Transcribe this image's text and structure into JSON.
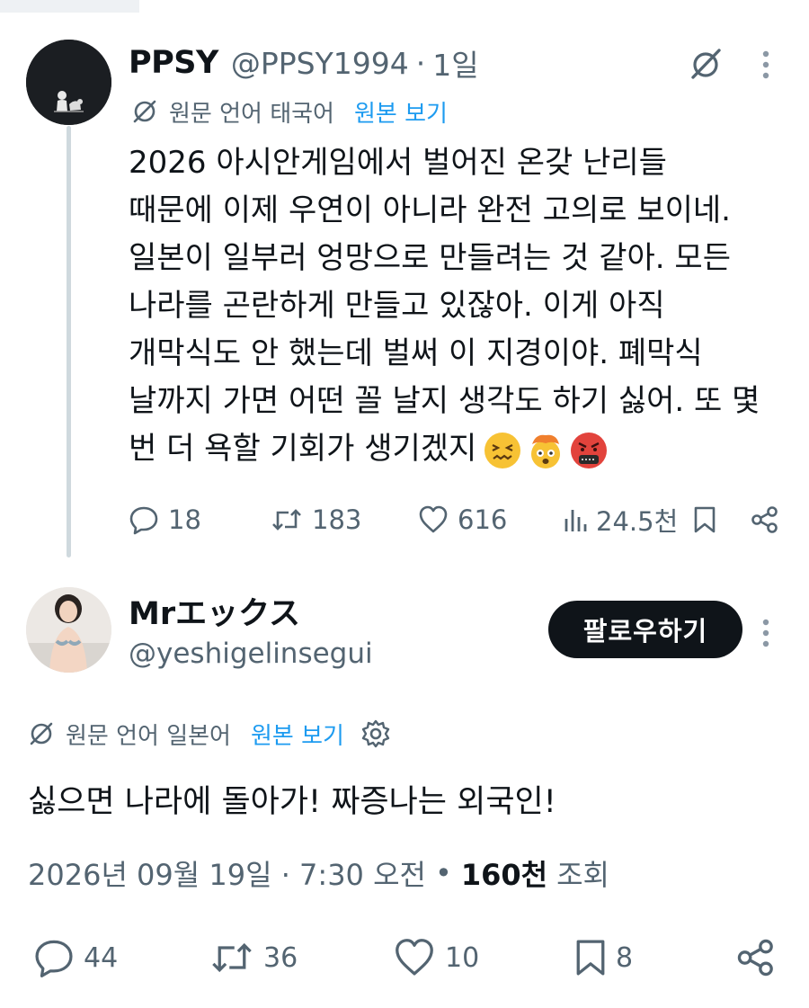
{
  "parent_tweet": {
    "display_name": "PPSY",
    "handle": "@PPSY1994",
    "separator": "·",
    "time_ago": "1일",
    "translate_label": "원문 언어 태국어",
    "show_original": "원본 보기",
    "body_lines": [
      "2026 아시안게임에서 벌어진 온갖 난리들",
      "때문에 이제 우연이 아니라 완전 고의로 보이네.",
      "일본이 일부러 엉망으로 만들려는 것 같아. 모든",
      "나라를 곤란하게 만들고 있잖아. 이게 아직",
      "개막식도 안 했는데 벌써 이 지경이야. 폐막식",
      "날까지 가면 어떤 꼴 날지 생각도 하기 싫어. 또 몇",
      "번 더 욕할 기회가 생기겠지"
    ],
    "emoji_icons": [
      "confounded-face-emoji",
      "exploding-head-emoji",
      "cursing-face-emoji"
    ],
    "stats": {
      "replies": "18",
      "reposts": "183",
      "likes": "616",
      "views": "24.5천"
    }
  },
  "reply_tweet": {
    "display_name": "Mrエックス",
    "handle": "@yeshigelinsegui",
    "follow_label": "팔로우하기",
    "translate_label": "원문 언어 일본어",
    "show_original": "원본 보기",
    "text": "싫으면 나라에 돌아가! 짜증나는 외국인!",
    "timestamp": "2026년 09월 19일 · 7:30 오전",
    "meta_separator": "•",
    "views_count": "160천",
    "views_label": "조회",
    "stats": {
      "replies": "44",
      "reposts": "36",
      "likes": "10",
      "bookmarks": "8"
    }
  },
  "colors": {
    "text_primary": "#0f1419",
    "text_secondary": "#536471",
    "link": "#1d9bf0",
    "thread_line": "#cfd9de",
    "follow_button_bg": "#0f1419"
  }
}
